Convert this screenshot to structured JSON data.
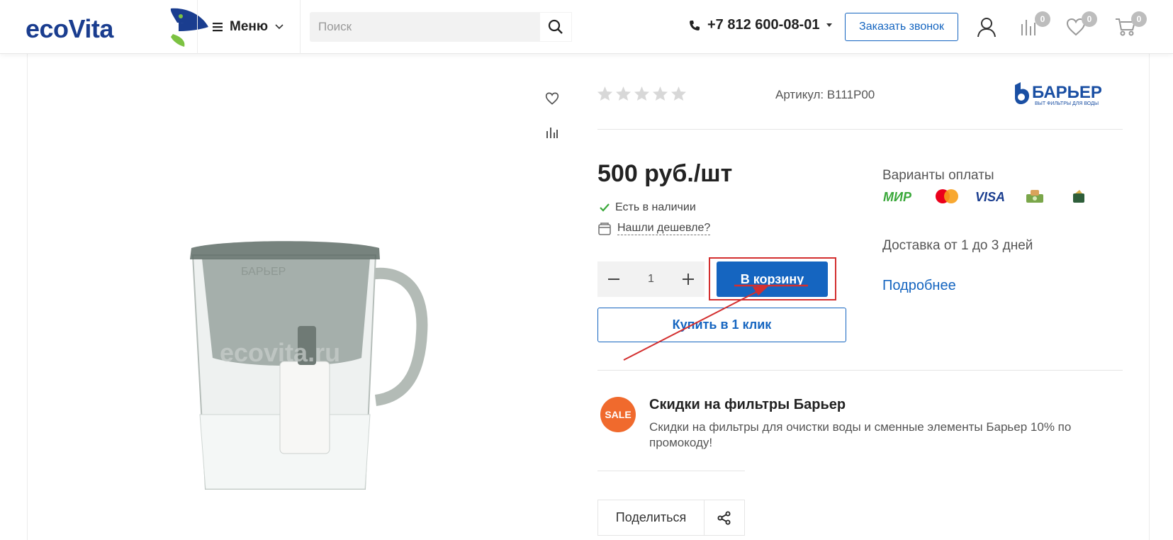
{
  "header": {
    "logo_text": "ecoVita",
    "menu_label": "Меню",
    "search_placeholder": "Поиск",
    "phone": "+7 812 600-08-01",
    "callback_label": "Заказать звонок",
    "compare_count": "0",
    "favorites_count": "0",
    "cart_count": "0"
  },
  "product": {
    "image_alt": "Кувшин-фильтр Барьер",
    "watermark": "ecovita.ru",
    "pitcher_brand": "БАРЬЕР",
    "rating": 0,
    "rating_max": 5,
    "article_label": "Артикул: B111P00",
    "brand_name": "БАРЬЕР",
    "brand_tagline": "ВЫТ ФИЛЬТРЫ ДЛЯ ВОДЫ",
    "price": "500 руб./шт",
    "stock": "Есть в наличии",
    "cheaper": "Нашли дешевле?",
    "quantity": "1",
    "add_to_cart": "В корзину",
    "buy_one_click": "Купить в 1 клик"
  },
  "payment": {
    "title": "Варианты оплаты",
    "methods": [
      "МИР",
      "MasterCard",
      "VISA",
      "cash",
      "wallet"
    ],
    "mir_label": "МИР",
    "visa_label": "VISA",
    "delivery": "Доставка от 1 до 3 дней",
    "more_link": "Подробнее"
  },
  "promo": {
    "badge": "SALE",
    "title": "Скидки на фильтры Барьер",
    "text": "Скидки на фильтры для очистки воды и сменные элементы Барьер 10% по промокоду!"
  },
  "share": {
    "label": "Поделиться"
  },
  "colors": {
    "accent": "#1565c0",
    "annotation": "#d32f2f",
    "sale": "#f06a2d",
    "logo": "#1a3d8f"
  }
}
